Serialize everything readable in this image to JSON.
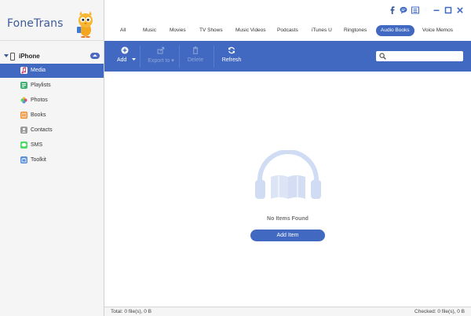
{
  "app": {
    "title": "FoneTrans"
  },
  "device": {
    "name": "iPhone"
  },
  "sidebar": {
    "items": [
      {
        "label": "Media",
        "icon": "music-note-icon",
        "color": "#e0457b",
        "active": true
      },
      {
        "label": "Playlists",
        "icon": "playlist-icon",
        "color": "#3cb371"
      },
      {
        "label": "Photos",
        "icon": "photos-icon",
        "color": "#f0a030"
      },
      {
        "label": "Books",
        "icon": "book-icon",
        "color": "#f28c28"
      },
      {
        "label": "Contacts",
        "icon": "contacts-icon",
        "color": "#8a8a8a"
      },
      {
        "label": "SMS",
        "icon": "sms-icon",
        "color": "#4cd964"
      },
      {
        "label": "Toolkit",
        "icon": "toolkit-icon",
        "color": "#5a8fd8"
      }
    ]
  },
  "tabs": [
    {
      "label": "All"
    },
    {
      "label": "Music"
    },
    {
      "label": "Movies"
    },
    {
      "label": "TV Shows"
    },
    {
      "label": "Music Videos"
    },
    {
      "label": "Podcasts"
    },
    {
      "label": "iTunes U"
    },
    {
      "label": "Ringtones"
    },
    {
      "label": "Audio Books",
      "active": true
    },
    {
      "label": "Voice Memos"
    }
  ],
  "toolbar": {
    "add_label": "Add",
    "export_label": "Export to",
    "delete_label": "Delete",
    "refresh_label": "Refresh"
  },
  "search": {
    "placeholder": ""
  },
  "content": {
    "empty_text": "No Items Found",
    "add_item_label": "Add Item"
  },
  "status": {
    "total": "Total: 0 file(s), 0 B",
    "checked": "Checked: 0 file(s), 0 B"
  },
  "colors": {
    "accent": "#4169c1",
    "brand_text": "#3d5b9a"
  }
}
